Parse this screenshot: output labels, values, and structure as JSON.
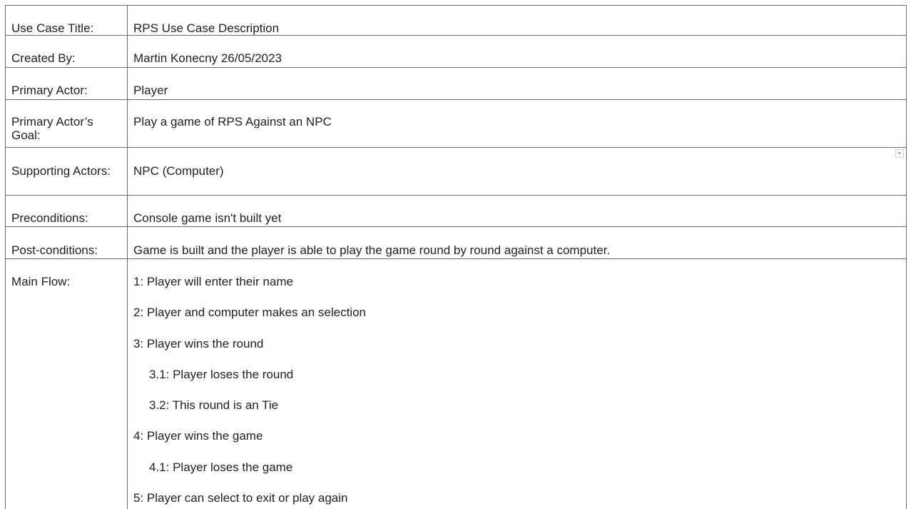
{
  "table": {
    "rows": [
      {
        "label": "Use Case Title:",
        "value": "RPS Use Case Description"
      },
      {
        "label": "Created By:",
        "value": "Martin Konecny 26/05/2023"
      },
      {
        "label": "Primary Actor:",
        "value": "Player"
      },
      {
        "label": "Primary Actor’s Goal:",
        "value": "Play a game of RPS Against an NPC"
      },
      {
        "label": "Supporting Actors:",
        "value": "NPC (Computer)"
      },
      {
        "label": "Preconditions:",
        "value": "Console game isn't built yet"
      },
      {
        "label": "Post-conditions:",
        "value": "Game is built and the player is able to play the game round by round against a computer."
      }
    ],
    "main_flow": {
      "label": "Main Flow:",
      "steps": [
        "1: Player will enter their name",
        "2: Player and computer makes an selection",
        "3: Player wins the round",
        "3.1: Player loses the round",
        "3.2: This round is an Tie",
        "4: Player wins the game",
        "4.1: Player loses the game",
        "5: Player can select to exit or play again"
      ]
    }
  },
  "icons": {
    "dropdown": "chevron-down-icon"
  }
}
